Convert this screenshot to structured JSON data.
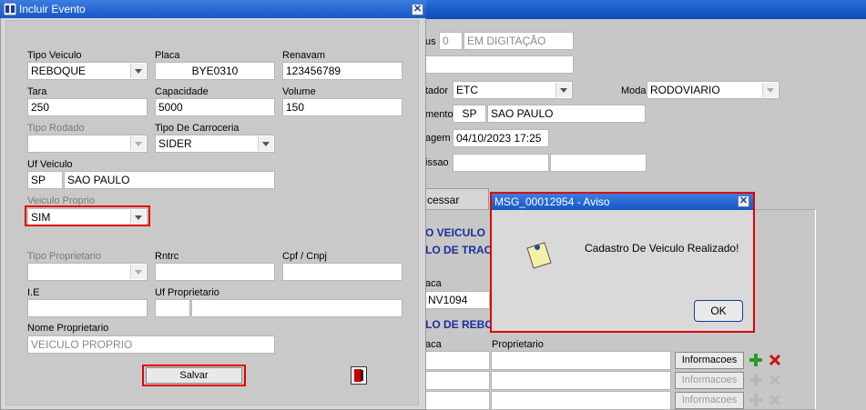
{
  "dialog": {
    "title": "Incluir Evento",
    "close_glyph": "✕",
    "tipo_veiculo": {
      "label": "Tipo Veiculo",
      "value": "REBOQUE"
    },
    "placa": {
      "label": "Placa",
      "value": "BYE0310"
    },
    "renavam": {
      "label": "Renavam",
      "value": "123456789"
    },
    "tara": {
      "label": "Tara",
      "value": "250"
    },
    "capacidade": {
      "label": "Capacidade",
      "value": "5000"
    },
    "volume": {
      "label": "Volume",
      "value": "150"
    },
    "tipo_rodado": {
      "label": "Tipo Rodado",
      "value": ""
    },
    "tipo_carroceria": {
      "label": "Tipo De Carroceria",
      "value": "SIDER"
    },
    "uf_veiculo": {
      "label": "Uf Veiculo",
      "uf": "SP",
      "name": "SAO PAULO"
    },
    "veiculo_proprio": {
      "label": "Veiculo  Proprio",
      "value": "SIM"
    },
    "tipo_proprietario": {
      "label": "Tipo Proprietario",
      "value": ""
    },
    "rntrc": {
      "label": "Rntrc",
      "value": ""
    },
    "cpf_cnpj": {
      "label": "Cpf / Cnpj",
      "value": ""
    },
    "ie": {
      "label": "I.E",
      "value": ""
    },
    "uf_proprietario": {
      "label": "Uf Proprietario",
      "value": ""
    },
    "nome_proprietario": {
      "label": "Nome Proprietario",
      "value": "VEICULO PROPRIO"
    },
    "save_label": "Salvar"
  },
  "background": {
    "status_label": "us",
    "status_code": "0",
    "status_text": "EM DIGITAÇÃO",
    "tador_label": "tador",
    "tador_value": "ETC",
    "modal_label": "Modal",
    "modal_value": "RODOVIARIO",
    "mento_label": "mento",
    "mento_uf": "SP",
    "mento_name": "SAO PAULO",
    "agem_label": "agem",
    "agem_value": "04/10/2023 17:25",
    "issao_label": "issao",
    "tab_label": "cessar",
    "section_veiculo": "O VEICULO",
    "section_traca": "LO DE TRACA",
    "aca_label": "aca",
    "placa_value": "NV1094",
    "section_reboq": "LO DE REBOQ",
    "aca2_label": "aca",
    "proprietario_label": "Proprietario",
    "info_buttons": [
      "Informacoes",
      "Informacoes",
      "Informacoes"
    ]
  },
  "message": {
    "title": "MSG_00012954 - Aviso",
    "text": "Cadastro De Veiculo Realizado!",
    "ok_label": "OK",
    "close_glyph": "✕"
  }
}
